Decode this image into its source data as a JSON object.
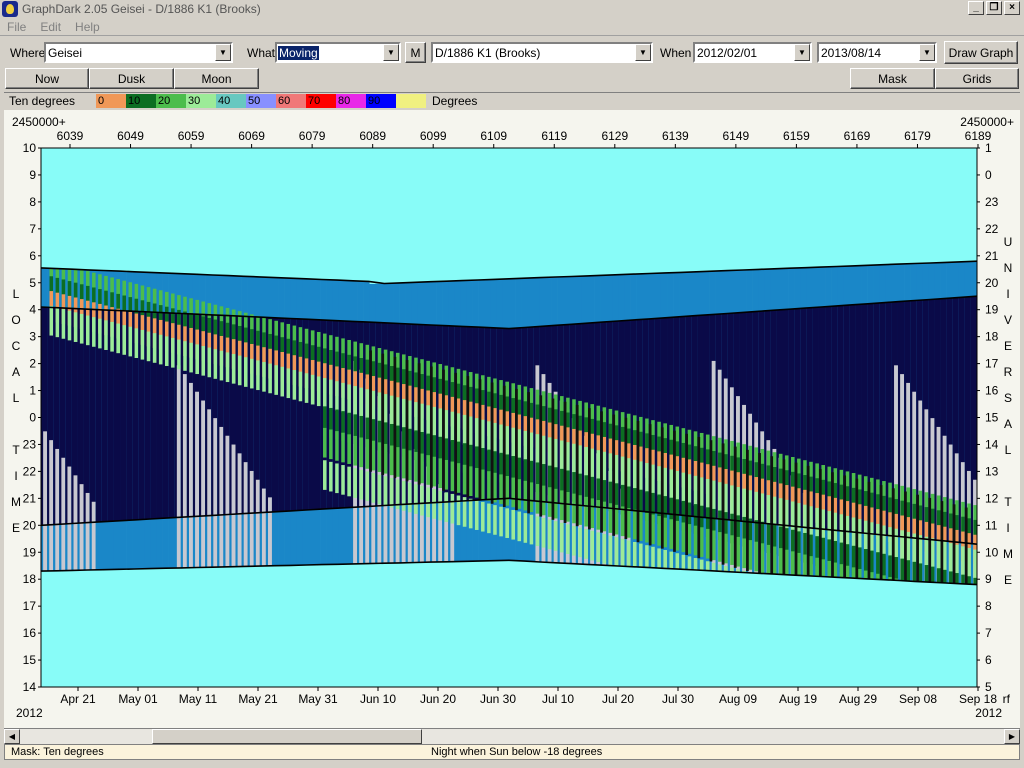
{
  "window": {
    "title": "GraphDark 2.05  Geisei  -  D/1886 K1 (Brooks)",
    "btn_min": "_",
    "btn_restore": "❐",
    "btn_close": "×"
  },
  "menu": {
    "file": "File",
    "edit": "Edit",
    "help": "Help"
  },
  "controls": {
    "where_label": "Where",
    "where_value": "Geisei",
    "what_label": "What",
    "what_value": "Moving",
    "m_button": "M",
    "object_value": "D/1886 K1 (Brooks)",
    "when_label": "When",
    "date_from": "2012/02/01",
    "date_to": "2013/08/14",
    "draw_button": "Draw Graph",
    "now_button": "Now",
    "dusk_button": "Dusk",
    "moon_button": "Moon",
    "mask_button": "Mask",
    "grids_button": "Grids"
  },
  "legend": {
    "title": "Ten degrees",
    "unit": "Degrees",
    "items": [
      {
        "label": "0",
        "color": "#f09858"
      },
      {
        "label": "10",
        "color": "#0c6e22"
      },
      {
        "label": "20",
        "color": "#4cbd4c"
      },
      {
        "label": "30",
        "color": "#9ceb98"
      },
      {
        "label": "40",
        "color": "#68c8c0"
      },
      {
        "label": "50",
        "color": "#8890ff"
      },
      {
        "label": "60",
        "color": "#f07878"
      },
      {
        "label": "70",
        "color": "#ff0000"
      },
      {
        "label": "80",
        "color": "#e828e8"
      },
      {
        "label": "90",
        "color": "#0000ff"
      },
      {
        "label": "",
        "color": "#f0f080"
      }
    ]
  },
  "chart_data": {
    "type": "heatmap",
    "jd_prefix": "2450000+",
    "jd_ticks": [
      "6039",
      "6049",
      "6059",
      "6069",
      "6079",
      "6089",
      "6099",
      "6109",
      "6119",
      "6129",
      "6139",
      "6149",
      "6159",
      "6169",
      "6179",
      "6189"
    ],
    "date_ticks": [
      "Apr 21",
      "May 01",
      "May 11",
      "May 21",
      "May 31",
      "Jun 10",
      "Jun 20",
      "Jun 30",
      "Jul 10",
      "Jul 20",
      "Jul 30",
      "Aug 09",
      "Aug 19",
      "Aug 29",
      "Sep 08",
      "Sep 18"
    ],
    "year_left": "2012",
    "year_right": "2012",
    "right_corner_label": "rf",
    "left_axis_hours": [
      "10",
      "9",
      "8",
      "7",
      "6",
      "5",
      "4",
      "3",
      "2",
      "1",
      "0",
      "23",
      "22",
      "21",
      "20",
      "19",
      "18",
      "17",
      "16",
      "15",
      "14"
    ],
    "right_axis_hours": [
      "1",
      "0",
      "23",
      "22",
      "21",
      "20",
      "19",
      "18",
      "17",
      "16",
      "15",
      "14",
      "13",
      "12",
      "11",
      "10",
      "9",
      "8",
      "7",
      "6",
      "5"
    ],
    "left_axis_label": [
      "L",
      "O",
      "C",
      "A",
      "L",
      "",
      "T",
      "I",
      "M",
      "E"
    ],
    "right_axis_label": [
      "U",
      "N",
      "I",
      "V",
      "E",
      "R",
      "S",
      "A",
      "L",
      "",
      "T",
      "I",
      "M",
      "E"
    ],
    "colors": {
      "daylight": "#88fcf8",
      "twilight": "#1a87c8",
      "moonlight": "#c8c8d0",
      "dark_night": "#0a0a48",
      "alt_0_10": "#f09858",
      "alt_10_20": "#0c6e22",
      "alt_20_30": "#4cbd4c",
      "alt_30_40": "#9ceb98",
      "alt_40_50": "#68c8c0"
    }
  },
  "status": {
    "mask": "Mask:  Ten degrees",
    "night": "Night when Sun below -18 degrees"
  }
}
